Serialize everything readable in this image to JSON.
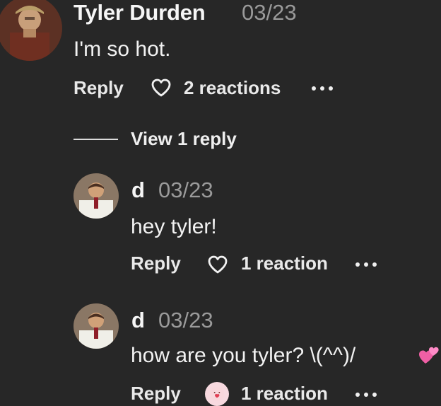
{
  "colors": {
    "background": "#272727",
    "primary_text": "#f2f2f2",
    "secondary_text": "#9a9a9a",
    "reaction_badge": "#f7d9df",
    "heart_emoji": "#e44a8f"
  },
  "comment": {
    "author": "Tyler Durden",
    "date": "03/23",
    "text": "I'm so hot.",
    "reply_label": "Reply",
    "reactions_label": "2 reactions",
    "more_icon": "more-horizontal-icon",
    "avatar_icon": "user-avatar"
  },
  "thread": {
    "view_replies_label": "View 1 reply"
  },
  "replies": [
    {
      "author": "d",
      "date": "03/23",
      "text": "hey tyler!",
      "reply_label": "Reply",
      "reactions_label": "1 reaction",
      "reaction_icon": "heart-outline-icon",
      "more_icon": "more-horizontal-icon"
    },
    {
      "author": "d",
      "date": "03/23",
      "text": "how are you tyler? \\(^^)/",
      "trailing_emoji_icon": "two-hearts-icon",
      "reply_label": "Reply",
      "reactions_label": "1 reaction",
      "reaction_icon": "face-blowing-kiss-icon",
      "more_icon": "more-horizontal-icon"
    }
  ]
}
